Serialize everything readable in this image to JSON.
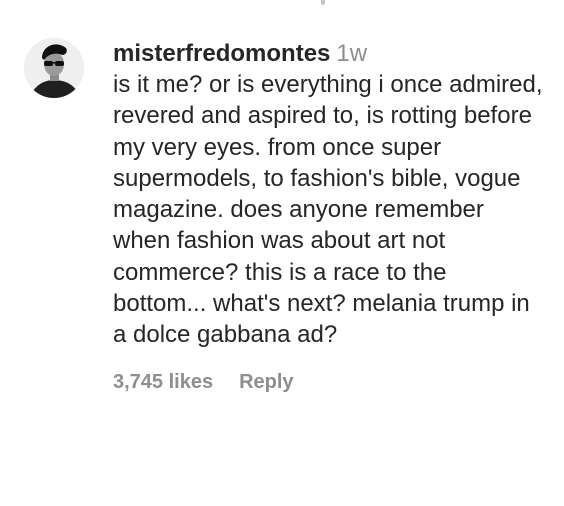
{
  "comment": {
    "username": "misterfredomontes",
    "timestamp": "1w",
    "text": "is it me? or is everything i once admired, revered and aspired to, is rotting before my very eyes. from once super supermodels, to fashion's bible, vogue magazine. does anyone remember when fashion was about art not commerce? this is a race to the bottom... what's next? melania trump in a dolce gabbana ad?",
    "likes": "3,745 likes",
    "reply_label": "Reply",
    "avatar_icon": "profile-avatar-icon"
  }
}
